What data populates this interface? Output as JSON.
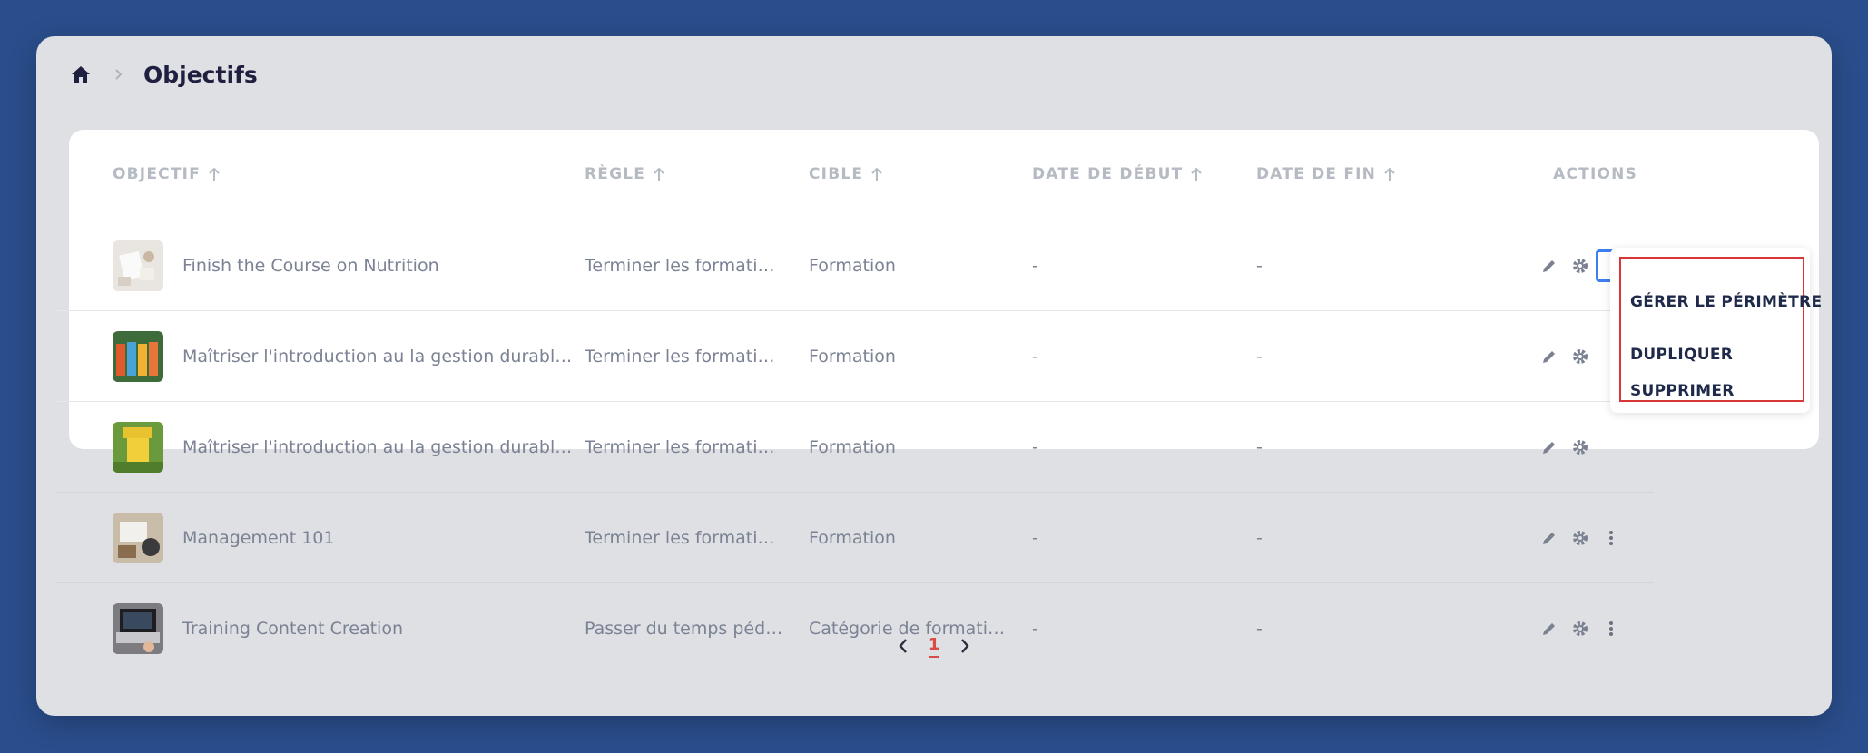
{
  "breadcrumb": {
    "title": "Objectifs"
  },
  "table": {
    "headers": {
      "objective": "OBJECTIF",
      "rule": "RÈGLE",
      "target": "CIBLE",
      "start_date": "DATE DE DÉBUT",
      "end_date": "DATE DE FIN",
      "actions": "ACTIONS"
    },
    "rows": [
      {
        "objective": "Finish the Course on Nutrition",
        "rule": "Terminer les formations",
        "target": "Formation",
        "start": "-",
        "end": "-"
      },
      {
        "objective": "Maîtriser l'introduction au la gestion durable de l...",
        "rule": "Terminer les formations",
        "target": "Formation",
        "start": "-",
        "end": "-"
      },
      {
        "objective": "Maîtriser l'introduction au la gestion durable de l...",
        "rule": "Terminer les formations",
        "target": "Formation",
        "start": "-",
        "end": "-"
      },
      {
        "objective": "Management 101",
        "rule": "Terminer les formations",
        "target": "Formation",
        "start": "-",
        "end": "-"
      },
      {
        "objective": "Training Content Creation",
        "rule": "Passer du temps pédago...",
        "target": "Catégorie de formation",
        "start": "-",
        "end": "-"
      }
    ]
  },
  "dropdown": {
    "items": [
      "GÉRER LE PÉRIMÈTRE",
      "DUPLIQUER",
      "SUPPRIMER"
    ]
  },
  "pagination": {
    "current": "1"
  },
  "colors": {
    "background": "#2a4e8c",
    "window": "#dfe0e3",
    "accent_blue": "#3d7ef0",
    "accent_red": "#d93737"
  }
}
